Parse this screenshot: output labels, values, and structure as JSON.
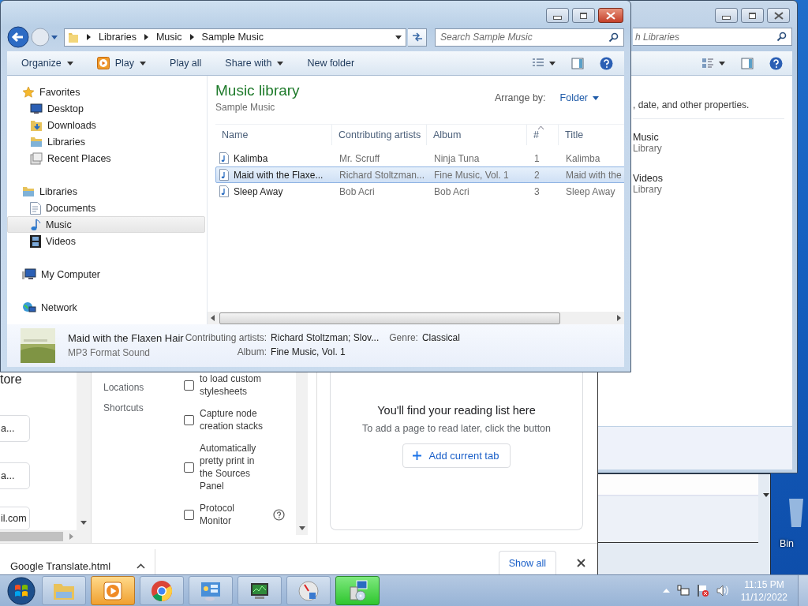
{
  "explorer": {
    "address": [
      "Libraries",
      "Music",
      "Sample Music"
    ],
    "search_placeholder": "Search Sample Music",
    "toolbar": [
      {
        "label": "Organize",
        "dropdown": true
      },
      {
        "label": "Play",
        "dropdown": true
      },
      {
        "label": "Play all",
        "dropdown": false
      },
      {
        "label": "Share with",
        "dropdown": true
      },
      {
        "label": "New folder",
        "dropdown": false
      }
    ],
    "nav": [
      {
        "label": "Favorites",
        "selected": false,
        "children": [
          {
            "label": "Desktop",
            "selected": false
          },
          {
            "label": "Downloads",
            "selected": false
          },
          {
            "label": "Libraries",
            "selected": false
          },
          {
            "label": "Recent Places",
            "selected": false
          }
        ]
      },
      {
        "label": "Libraries",
        "selected": false,
        "children": [
          {
            "label": "Documents",
            "selected": false
          },
          {
            "label": "Music",
            "selected": true
          },
          {
            "label": "Videos",
            "selected": false
          }
        ]
      },
      {
        "label": "My Computer",
        "selected": false
      },
      {
        "label": "Network",
        "selected": false
      }
    ],
    "library": {
      "title": "Music library",
      "subtitle": "Sample Music",
      "arrange_label": "Arrange by:",
      "arrange_value": "Folder"
    },
    "columns": [
      {
        "label": "Name",
        "sorted": false
      },
      {
        "label": "Contributing artists",
        "sorted": false
      },
      {
        "label": "Album",
        "sorted": false
      },
      {
        "label": "#",
        "sorted": true
      },
      {
        "label": "Title",
        "sorted": false
      }
    ],
    "rows": [
      {
        "cells": [
          "Kalimba",
          "Mr. Scruff",
          "Ninja Tuna",
          "1",
          "Kalimba"
        ],
        "selected": false
      },
      {
        "cells": [
          "Maid with the Flaxe...",
          "Richard Stoltzman...",
          "Fine Music, Vol. 1",
          "2",
          "Maid with the"
        ],
        "selected": true
      },
      {
        "cells": [
          "Sleep Away",
          "Bob Acri",
          "Bob Acri",
          "3",
          "Sleep Away"
        ],
        "selected": false
      }
    ],
    "details": {
      "title": "Maid with the Flaxen Hair",
      "type": "MP3 Format Sound",
      "fields": [
        {
          "label": "Contributing artists:",
          "value": "Richard Stoltzman; Slov..."
        },
        {
          "label": "Album:",
          "value": "Fine Music, Vol. 1"
        },
        {
          "label": "Genre:",
          "value": "Classical"
        }
      ]
    }
  },
  "back_window": {
    "search_placeholder": "h Libraries",
    "description": ", date, and other properties.",
    "libraries": [
      {
        "name": "Music",
        "type": "Library"
      },
      {
        "name": "Videos",
        "type": "Library"
      }
    ]
  },
  "desktop": {
    "icon_label": "Bin"
  },
  "browser": {
    "left_panel": {
      "heading": "tore",
      "fields": [
        "a...",
        "a...",
        "il.com"
      ]
    },
    "settings_nav": [
      "Locations",
      "Shortcuts"
    ],
    "experiments": [
      {
        "label": "to load custom stylesheets",
        "checked": false,
        "help": false
      },
      {
        "label": "Capture node creation stacks",
        "checked": false,
        "help": false
      },
      {
        "label": "Automatically pretty print in the Sources Panel",
        "checked": false,
        "help": false
      },
      {
        "label": "Protocol Monitor",
        "checked": false,
        "help": true
      }
    ],
    "reading_list": {
      "title": "You'll find your reading list here",
      "hint": "To add a page to read later, click the button",
      "button": "Add current tab"
    },
    "download": {
      "file": "Google Translate.html",
      "show_all": "Show all"
    }
  },
  "taskbar": {
    "time": "11:15 PM",
    "date": "11/12/2022"
  }
}
